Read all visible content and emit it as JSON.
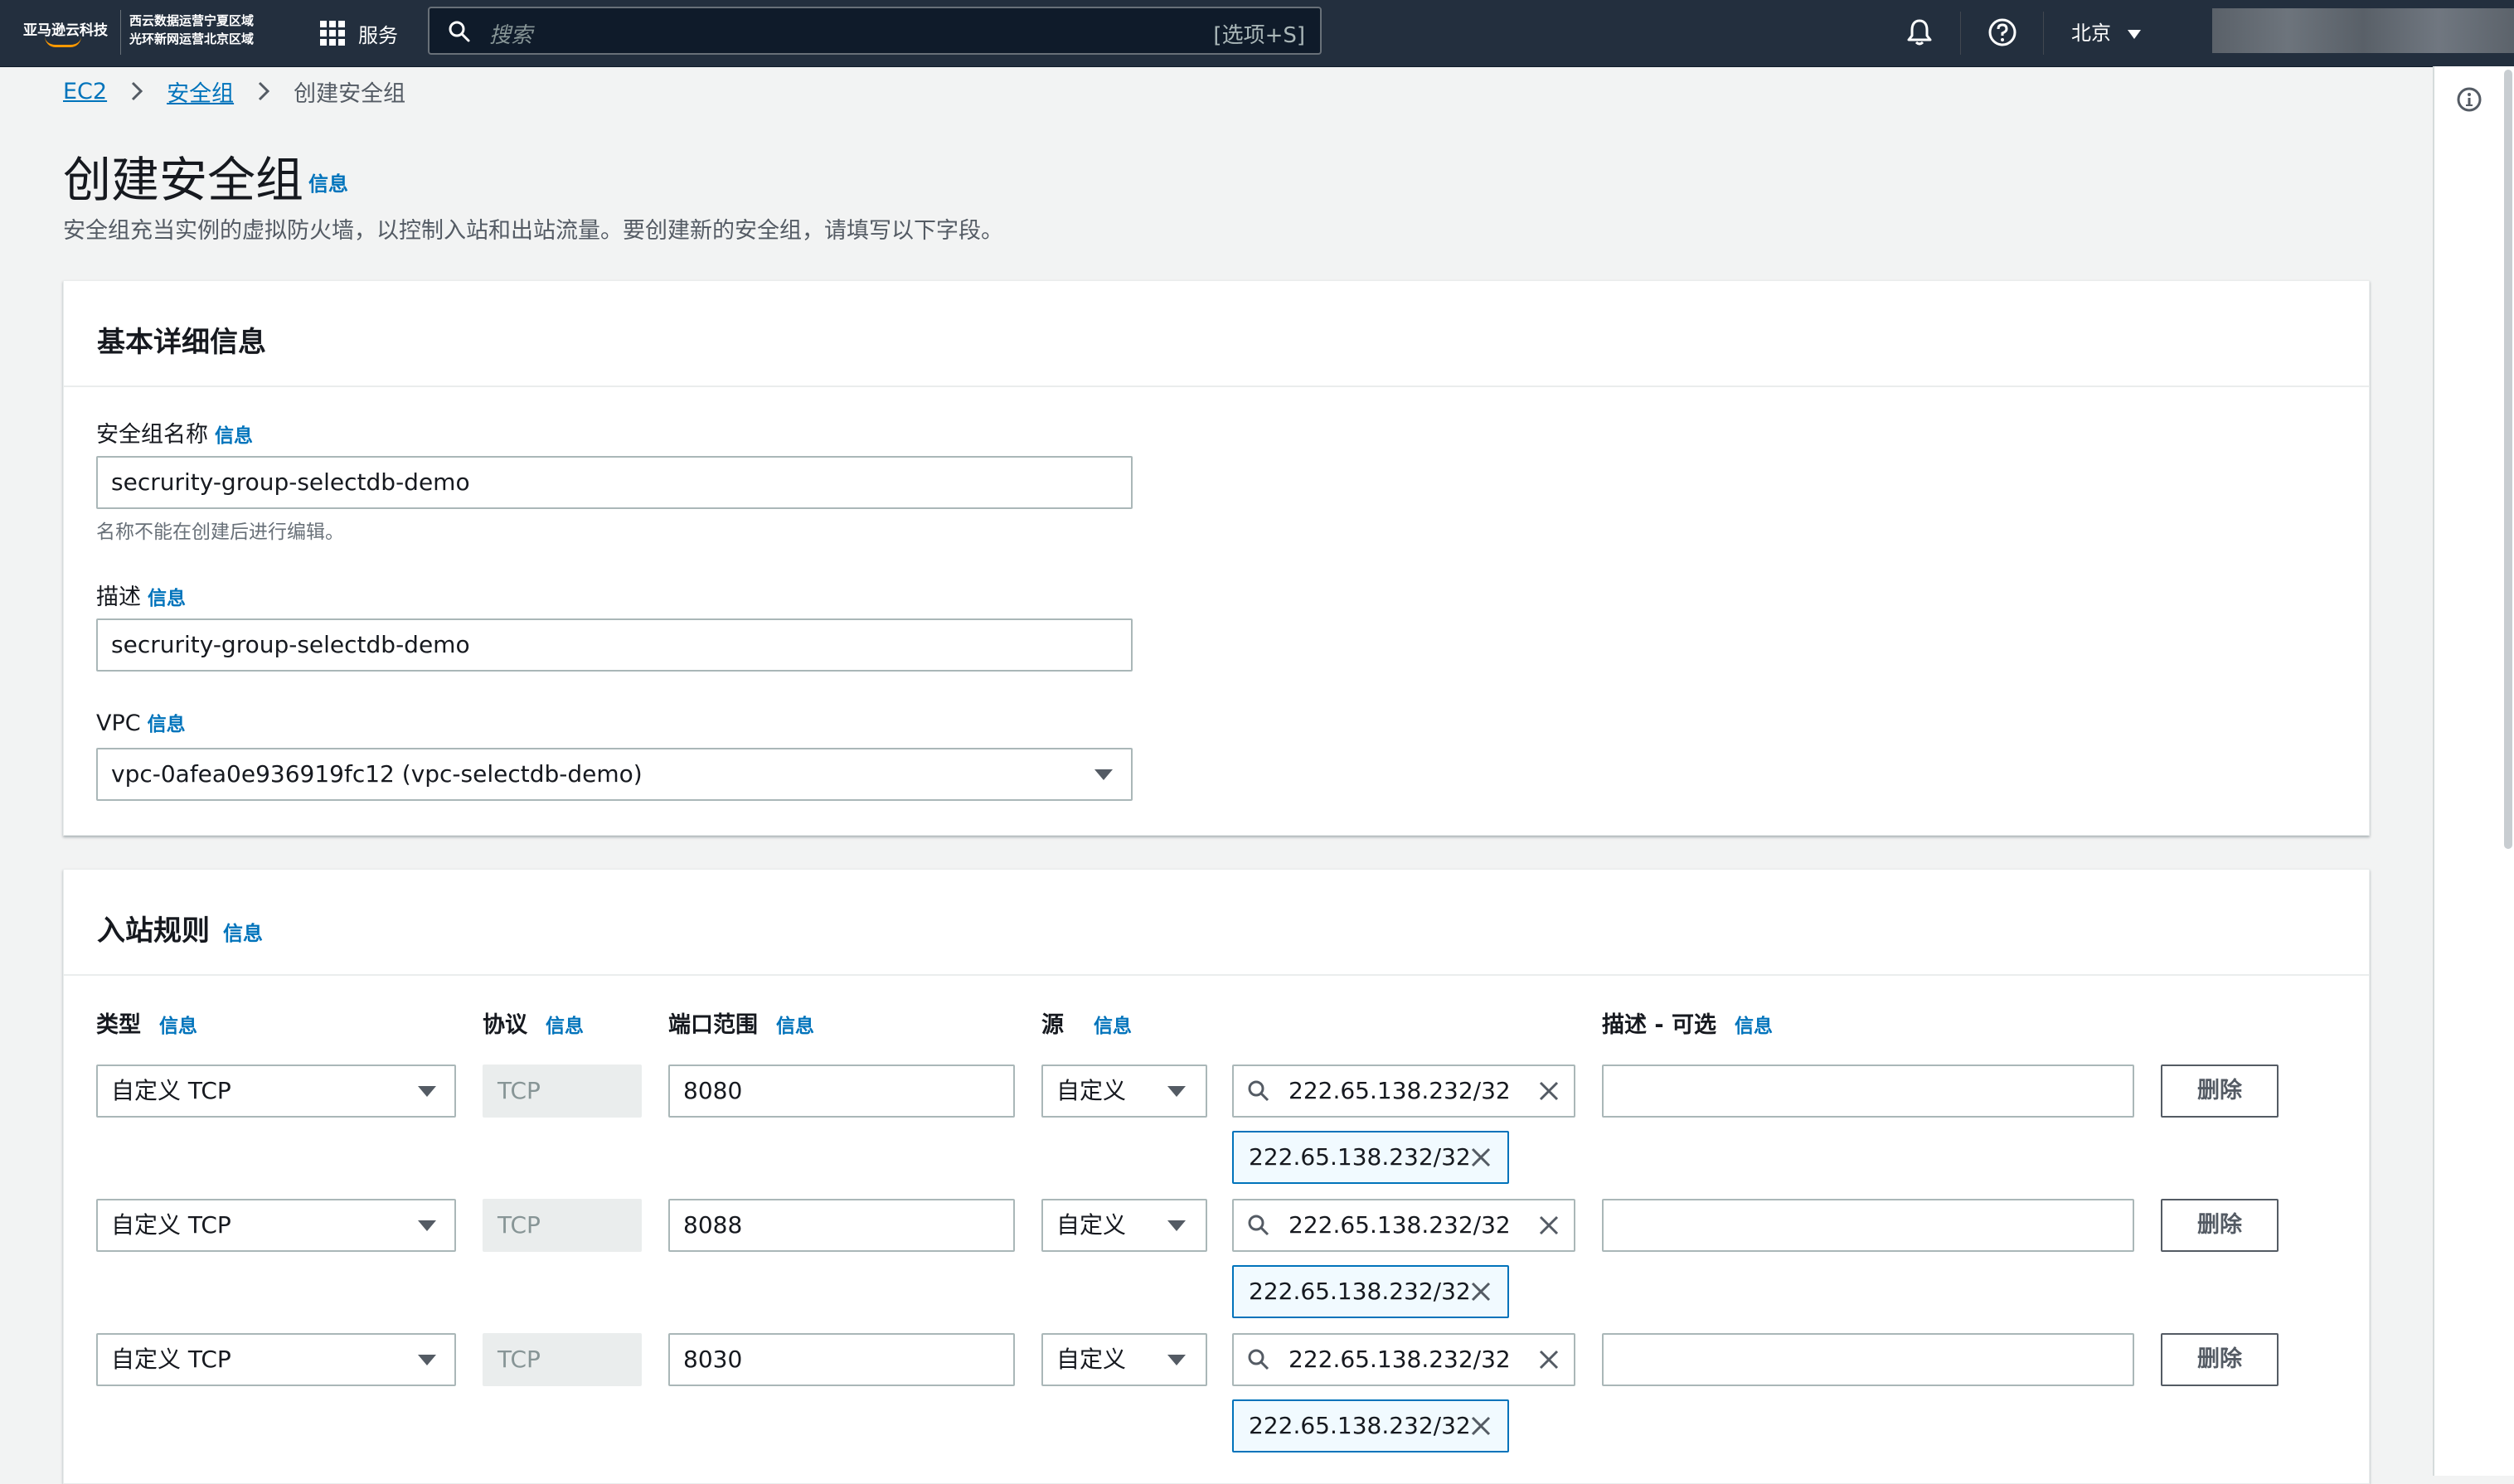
{
  "topbar": {
    "logo_text": "亚马逊云科技",
    "region_note_1": "西云数据运营宁夏区域",
    "region_note_2": "光环新网运营北京区域",
    "services_label": "服务",
    "search_placeholder": "搜索",
    "search_shortcut": "[选项+S]",
    "region_label": "北京"
  },
  "breadcrumb": [
    "EC2",
    "安全组",
    "创建安全组"
  ],
  "header": {
    "title": "创建安全组",
    "info_link": "信息",
    "description": "安全组充当实例的虚拟防火墙，以控制入站和出站流量。要创建新的安全组，请填写以下字段。"
  },
  "basic": {
    "title": "基本详细信息",
    "name_label": "安全组名称",
    "name_info": "信息",
    "name_value": "secrurity-group-selectdb-demo",
    "name_hint": "名称不能在创建后进行编辑。",
    "desc_label": "描述",
    "desc_info": "信息",
    "desc_value": "secrurity-group-selectdb-demo",
    "vpc_label": "VPC",
    "vpc_info": "信息",
    "vpc_value": "vpc-0afea0e936919fc12 (vpc-selectdb-demo)"
  },
  "inbound": {
    "title": "入站规则",
    "info": "信息",
    "columns": {
      "type": "类型",
      "type_info": "信息",
      "protocol": "协议",
      "protocol_info": "信息",
      "port": "端口范围",
      "port_info": "信息",
      "source": "源",
      "source_info": "信息",
      "desc": "描述 - 可选",
      "desc_info": "信息"
    },
    "rules": [
      {
        "type": "自定义 TCP",
        "protocol": "TCP",
        "port": "8080",
        "source_type": "自定义",
        "source_search": "222.65.138.232/32",
        "token": "222.65.138.232/32",
        "description": "",
        "delete": "删除"
      },
      {
        "type": "自定义 TCP",
        "protocol": "TCP",
        "port": "8088",
        "source_type": "自定义",
        "source_search": "222.65.138.232/32",
        "token": "222.65.138.232/32",
        "description": "",
        "delete": "删除"
      },
      {
        "type": "自定义 TCP",
        "protocol": "TCP",
        "port": "8030",
        "source_type": "自定义",
        "source_search": "222.65.138.232/32",
        "token": "222.65.138.232/32",
        "description": "",
        "delete": "删除"
      }
    ]
  },
  "colors": {
    "topbar": "#232f3e",
    "link": "#0073bb",
    "accent": "#ff9900"
  },
  "icons": [
    "grid-icon",
    "search-icon",
    "bell-icon",
    "help-icon",
    "caret-down-icon",
    "chevron-right-icon",
    "close-icon",
    "info-icon"
  ]
}
